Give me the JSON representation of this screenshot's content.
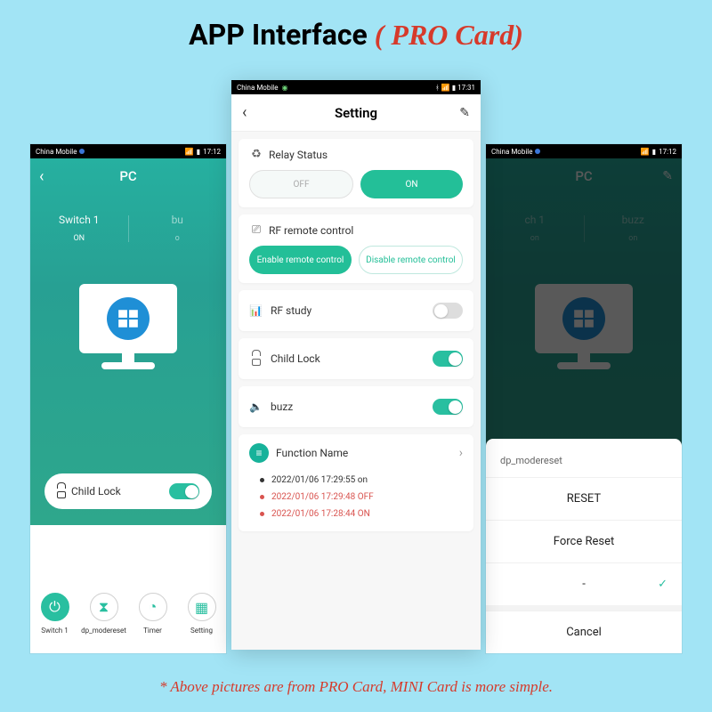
{
  "header": {
    "title_black": "APP Interface ",
    "title_red": "( PRO Card)"
  },
  "footnote": "* Above pictures are from PRO Card, MINI Card is more simple.",
  "left_phone": {
    "status_carrier": "China Mobile",
    "status_time": "17:12",
    "title": "PC",
    "switch1_label": "Switch 1",
    "switch1_value": "ON",
    "switch2_label": "bu",
    "switch2_value": "o",
    "child_lock_label": "Child Lock",
    "bottom": {
      "b1": "Switch 1",
      "b2": "dp_modereset",
      "b3": "Timer",
      "b4": "Setting"
    }
  },
  "right_phone": {
    "status_carrier": "China Mobile",
    "status_time": "17:12",
    "title": "PC",
    "sheet_title": "dp_modereset",
    "opt1": "RESET",
    "opt2": "Force Reset",
    "opt3": "-",
    "cancel": "Cancel"
  },
  "center_phone": {
    "status_carrier": "China Mobile",
    "status_time": "17:31",
    "title": "Setting",
    "relay_label": "Relay Status",
    "relay_off": "OFF",
    "relay_on": "ON",
    "rf_label": "RF remote control",
    "rf_enable": "Enable remote control",
    "rf_disable": "Disable remote control",
    "rf_study": "RF study",
    "child_lock": "Child Lock",
    "buzz": "buzz",
    "func_name": "Function Name",
    "log1": "2022/01/06 17:29:55 on",
    "log2": "2022/01/06 17:29:48 OFF",
    "log3": "2022/01/06 17:28:44 ON"
  }
}
